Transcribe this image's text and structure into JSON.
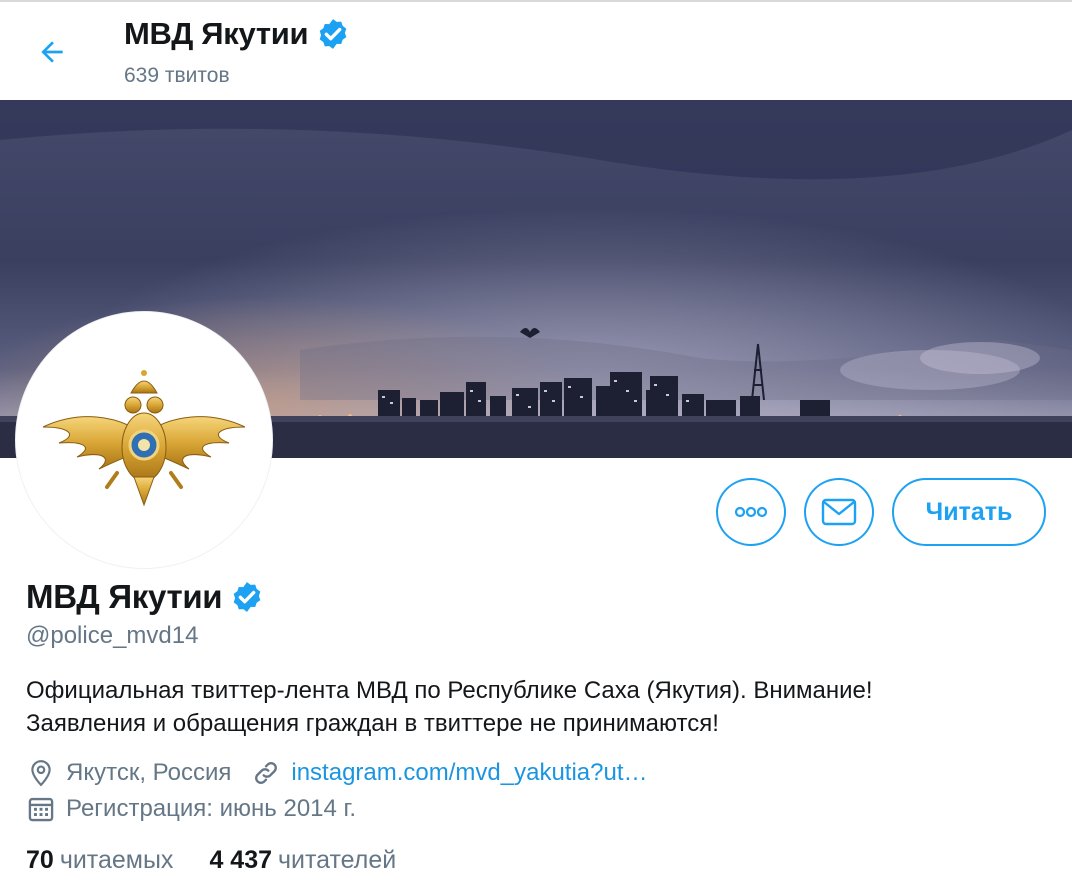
{
  "header": {
    "title": "МВД Якутии",
    "tweet_count": "639 твитов"
  },
  "profile": {
    "name": "МВД Якутии",
    "handle": "@police_mvd14",
    "bio_line1": "Официальная твиттер-лента МВД по Республике Саха (Якутия). Внимание!",
    "bio_line2": "Заявления и обращения граждан в твиттере не принимаются!",
    "location": "Якутск, Россия",
    "website": "instagram.com/mvd_yakutia?ut…",
    "joined": "Регистрация: июнь 2014 г."
  },
  "actions": {
    "follow_label": "Читать"
  },
  "stats": {
    "following_count": "70",
    "following_label": "читаемых",
    "followers_count": "4 437",
    "followers_label": "читателей"
  },
  "icons": {
    "back": "back-arrow-icon",
    "verified": "verified-badge-icon",
    "more": "more-dots-icon",
    "message": "envelope-icon",
    "location": "location-pin-icon",
    "link": "link-icon",
    "calendar": "calendar-icon"
  },
  "colors": {
    "accent": "#1da1f2",
    "link": "#1b95e0",
    "secondary_text": "#657786",
    "primary_text": "#14171a"
  }
}
